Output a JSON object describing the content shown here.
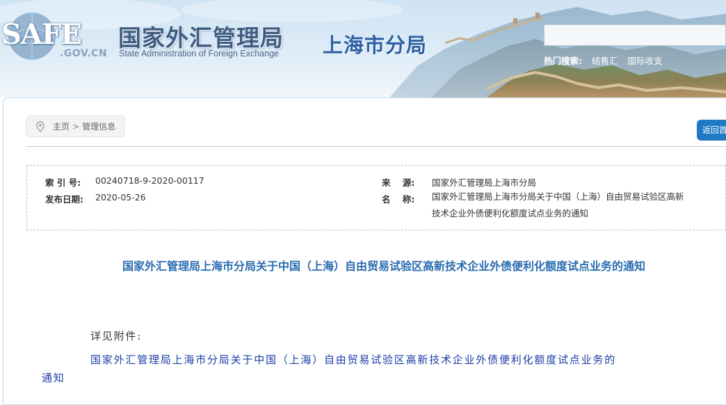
{
  "header": {
    "logo_main": "SAFE",
    "logo_domain": ".GOV.CN",
    "org_name_cn": "国家外汇管理局",
    "org_name_en": "State Administration of Foreign Exchange",
    "branch_name": "上海市分局",
    "search_value": "",
    "hot_search_label": "热门搜索:",
    "hot_search_links": [
      "结售汇",
      "国际收支"
    ]
  },
  "nav": {
    "breadcrumb_home": "主页",
    "breadcrumb_separator": ">",
    "breadcrumb_current": "管理信息",
    "home_button": "返回首页"
  },
  "meta": {
    "index_label": "索 引 号:",
    "index_value": "00240718-9-2020-00117",
    "date_label": "发布日期:",
    "date_value": "2020-05-26",
    "source_label": "来    源:",
    "source_value": "国家外汇管理局上海市分局",
    "name_label": "名    称:",
    "name_value": "国家外汇管理局上海市分局关于中国（上海）自由贸易试验区高新技术企业外债便利化额度试点业务的通知"
  },
  "article": {
    "title": "国家外汇管理局上海市分局关于中国（上海）自由贸易试验区高新技术企业外债便利化额度试点业务的通知",
    "see_attachment": "详见附件:",
    "attachment_line1": "国家外汇管理局上海市分局关于中国（上海）自由贸易试验区高新技术企业外债便利化额度试点业务的",
    "attachment_line2": "通知"
  },
  "colors": {
    "accent_blue": "#1f79c4",
    "title_blue": "#2a6cb0",
    "link_blue": "#1a3ea8",
    "branch_blue": "#2d5fa3"
  }
}
